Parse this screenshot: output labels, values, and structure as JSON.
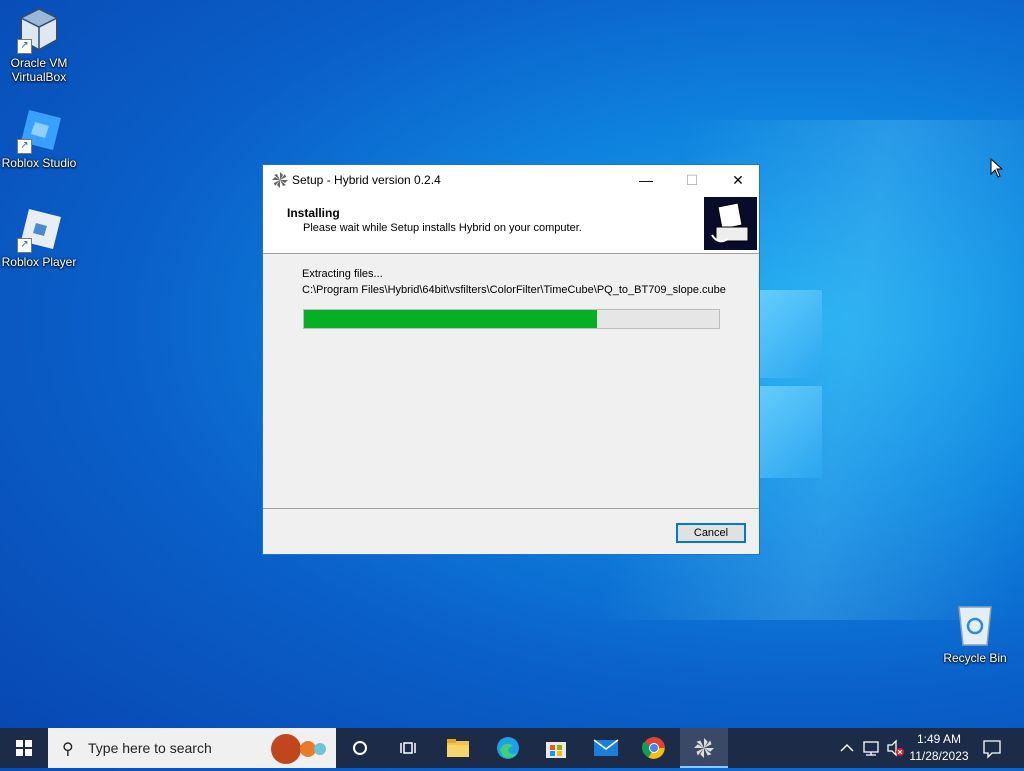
{
  "desktop": {
    "icons": [
      {
        "label_line1": "Oracle VM",
        "label_line2": "VirtualBox"
      },
      {
        "label": "Roblox Studio"
      },
      {
        "label": "Roblox Player"
      },
      {
        "label": "Recycle Bin"
      }
    ]
  },
  "dialog": {
    "title": "Setup - Hybrid version 0.2.4",
    "minimize_glyph": "—",
    "maximize_glyph": "☐",
    "close_glyph": "✕",
    "heading": "Installing",
    "subheading": "Please wait while Setup installs Hybrid on your computer.",
    "status": "Extracting files...",
    "current_file": "C:\\Program Files\\Hybrid\\64bit\\vsfilters\\ColorFilter\\TimeCube\\PQ_to_BT709_slope.cube",
    "progress_fraction": 0.705,
    "cancel_label": "Cancel"
  },
  "taskbar": {
    "search_placeholder": "Type here to search",
    "apps": [
      "start-icon",
      "cortana-icon",
      "task-view-icon",
      "file-explorer-icon",
      "edge-icon",
      "store-icon",
      "mail-icon",
      "chrome-icon",
      "hybrid-setup-icon"
    ],
    "clock_time": "1:49 AM",
    "clock_date": "11/28/2023"
  },
  "colors": {
    "progress_fill": "#06b025",
    "taskbar_bg": "#1c2c48",
    "desktop_blue": "#0a5fc8"
  }
}
